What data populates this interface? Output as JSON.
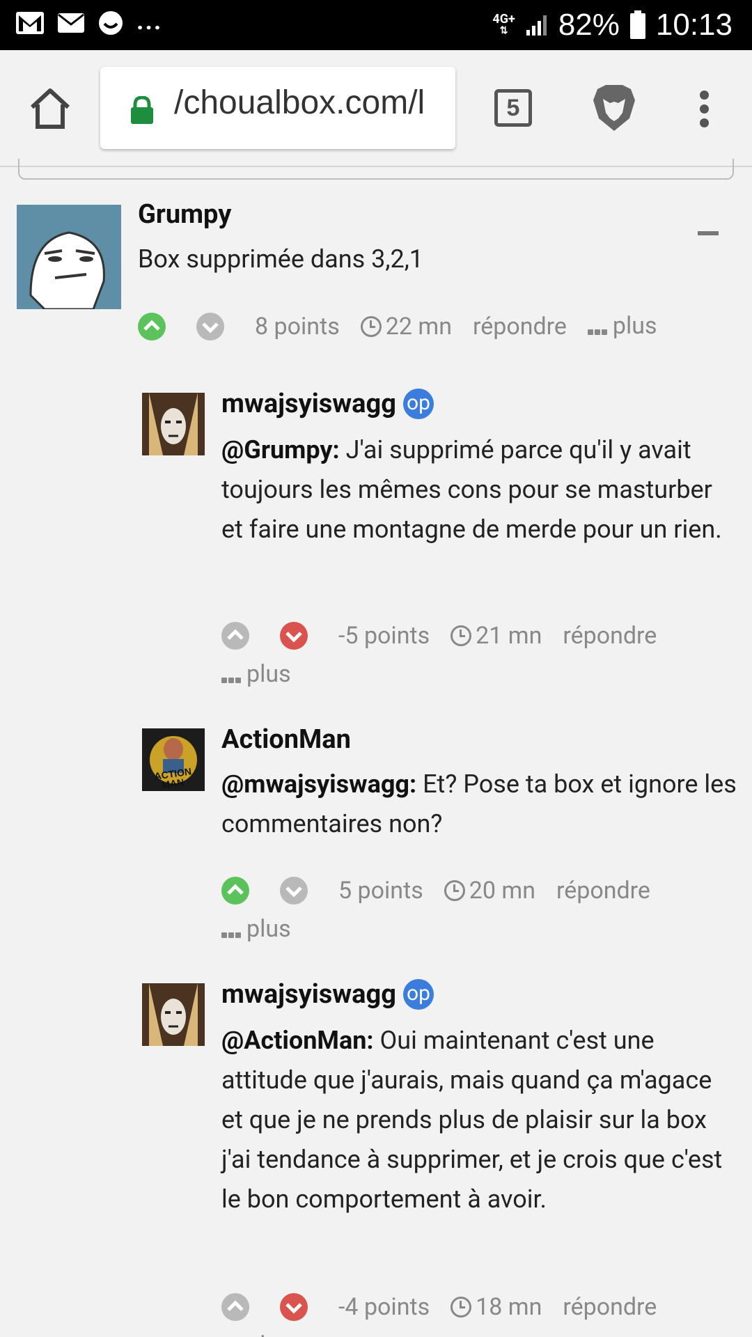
{
  "status_bar": {
    "battery": "82%",
    "time": "10:13",
    "network": "4G+",
    "notification_icons": [
      "gmail-icon",
      "mail-icon",
      "messenger-icon"
    ],
    "more": "..."
  },
  "browser": {
    "url": "/choualbox.com/l",
    "tab_count": "5"
  },
  "comments": [
    {
      "author": "Grumpy",
      "op": false,
      "mention": "",
      "text": "Box supprimée dans 3,2,1",
      "points": "8 points",
      "time": "22 mn",
      "reply_label": "répondre",
      "more_label": "plus",
      "vote": "up"
    },
    {
      "author": "mwajsyiswagg",
      "op": true,
      "op_label": "op",
      "mention": "@Grumpy:",
      "text": " J'ai supprimé parce qu'il y avait toujours les mêmes cons pour se masturber et faire une montagne de merde pour un rien.",
      "points": "-5 points",
      "time": "21 mn",
      "reply_label": "répondre",
      "more_label": "plus",
      "vote": "down"
    },
    {
      "author": "ActionMan",
      "op": false,
      "mention": "@mwajsyiswagg:",
      "text": " Et? Pose ta box et ignore les commentaires non?",
      "points": "5 points",
      "time": "20 mn",
      "reply_label": "répondre",
      "more_label": "plus",
      "vote": "up"
    },
    {
      "author": "mwajsyiswagg",
      "op": true,
      "op_label": "op",
      "mention": "@ActionMan:",
      "text": " Oui maintenant c'est une attitude que j'aurais, mais quand ça m'agace et que je ne prends plus de plaisir sur la box j'ai tendance à supprimer, et je crois que c'est le bon comportement à avoir.",
      "points": "-4 points",
      "time": "18 mn",
      "reply_label": "répondre",
      "more_label": "plus",
      "vote": "down"
    }
  ],
  "colors": {
    "upvote": "#5cc35c",
    "downvote": "#d9534f",
    "op_badge": "#3b7ddd",
    "lock": "#1e8e3e"
  }
}
